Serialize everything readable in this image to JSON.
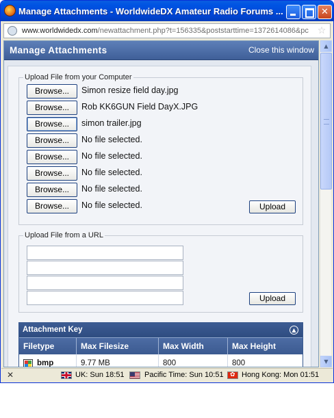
{
  "window": {
    "title": "Manage Attachments - WorldwideDX Amateur Radio Forums ...",
    "url_domain": "www.worldwidedx.com",
    "url_rest": "/newattachment.php?t=156335&poststarttime=1372614086&pc"
  },
  "dialog": {
    "title": "Manage Attachments",
    "close_label": "Close this window"
  },
  "upload_computer": {
    "legend": "Upload File from your Computer",
    "browse_label": "Browse...",
    "files": [
      "Simon resize field day.jpg",
      "Rob KK6GUN Field DayX.JPG",
      "simon trailer.jpg",
      "No file selected.",
      "No file selected.",
      "No file selected.",
      "No file selected.",
      "No file selected."
    ],
    "upload_label": "Upload"
  },
  "upload_url": {
    "legend": "Upload File from a URL",
    "upload_label": "Upload"
  },
  "attachment_key": {
    "title": "Attachment Key",
    "columns": [
      "Filetype",
      "Max Filesize",
      "Max Width",
      "Max Height"
    ],
    "rows": [
      [
        "bmp",
        "9.77 MB",
        "800",
        "800"
      ]
    ]
  },
  "status_bar": {
    "uk_time": "UK: Sun 18:51",
    "pacific_time": "Pacific Time: Sun 10:51",
    "hk_time": "Hong Kong: Mon 01:51"
  },
  "icons": {
    "app": "firefox-icon",
    "globe": "globe-icon",
    "bookmark": "bookmark-icon",
    "collapse": "collapse-icon",
    "filetype": "bmp-file-icon"
  },
  "colors": {
    "titlebar": "#0054e3",
    "dialog_header": "#4a6ca6",
    "key_header": "#3b5a90"
  }
}
